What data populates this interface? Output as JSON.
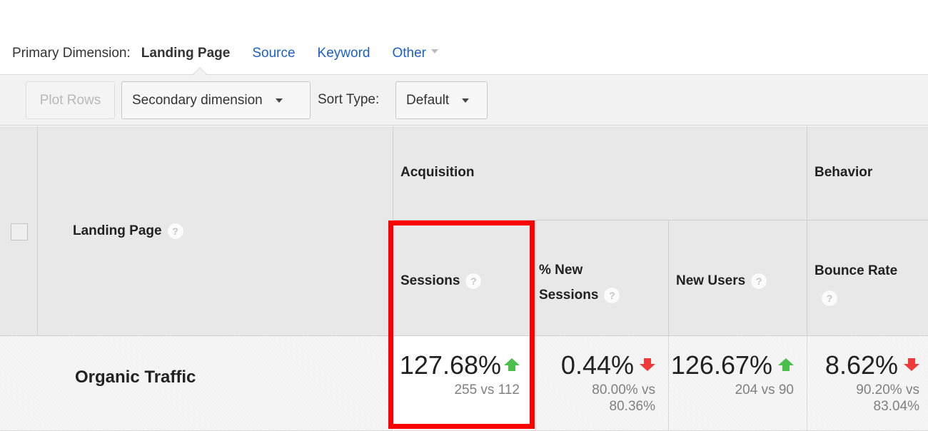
{
  "primary_dimension": {
    "label": "Primary Dimension:",
    "active": "Landing Page",
    "links": [
      "Source",
      "Keyword",
      "Other"
    ]
  },
  "toolbar": {
    "plot_rows_label": "Plot Rows",
    "secondary_dimension_label": "Secondary dimension",
    "sort_type_label": "Sort Type:",
    "sort_type_value": "Default"
  },
  "table": {
    "groups": {
      "acquisition": "Acquisition",
      "behavior": "Behavior"
    },
    "columns": {
      "landing_page": "Landing Page",
      "sessions": "Sessions",
      "pct_new_sessions_line1": "% New",
      "pct_new_sessions_line2": "Sessions",
      "new_users": "New Users",
      "bounce_rate": "Bounce Rate"
    },
    "help_glyph": "?",
    "rows": [
      {
        "label": "Organic Traffic",
        "sessions": {
          "change": "127.68%",
          "direction": "up",
          "compare": "255 vs 112"
        },
        "pct_new_sessions": {
          "change": "0.44%",
          "direction": "down",
          "compare": "80.00% vs 80.36%"
        },
        "new_users": {
          "change": "126.67%",
          "direction": "up",
          "compare": "204 vs 90"
        },
        "bounce_rate": {
          "change": "8.62%",
          "direction": "down",
          "compare": "90.20% vs 83.04%"
        }
      }
    ]
  },
  "colors": {
    "link": "#1a5fd0",
    "up": "#4bbf4a",
    "down": "#f03a3a",
    "highlight_box": "#ff0000"
  }
}
